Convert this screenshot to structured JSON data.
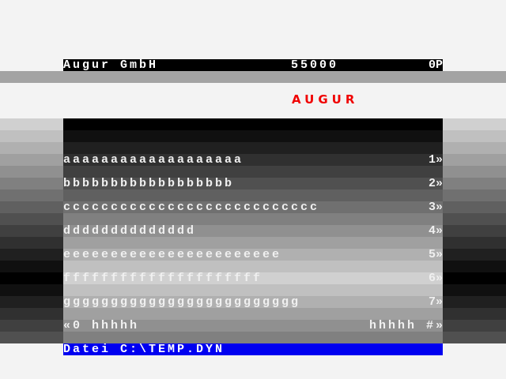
{
  "header": {
    "company": "Augur GmbH",
    "amount": "55000",
    "points": "0P"
  },
  "logo": "AUGUR",
  "colors": {
    "logo": "#f00000",
    "footer": "#0000f0",
    "header": "#000000",
    "text": "#f0f0f0"
  },
  "items": [
    {
      "label": "aaaaaaaaaaaaaaaaaaa",
      "key": "1»"
    },
    {
      "label": "bbbbbbbbbbbbbbbbbb",
      "key": "2»"
    },
    {
      "label": "ccccccccccccccccccccccccccc",
      "key": "3»"
    },
    {
      "label": "dddddddddddddd",
      "key": "4»"
    },
    {
      "label": "eeeeeeeeeeeeeeeeeeeeeee",
      "key": "5»"
    },
    {
      "label": "fffffffffffffffffffff",
      "key": "6»"
    },
    {
      "label": "ggggggggggggggggggggggggg",
      "key": "7»"
    }
  ],
  "nav": {
    "left": "«0 hhhhh",
    "right": "hhhhh #»"
  },
  "footer": {
    "file": "Datei C:\\TEMP.DYN"
  }
}
